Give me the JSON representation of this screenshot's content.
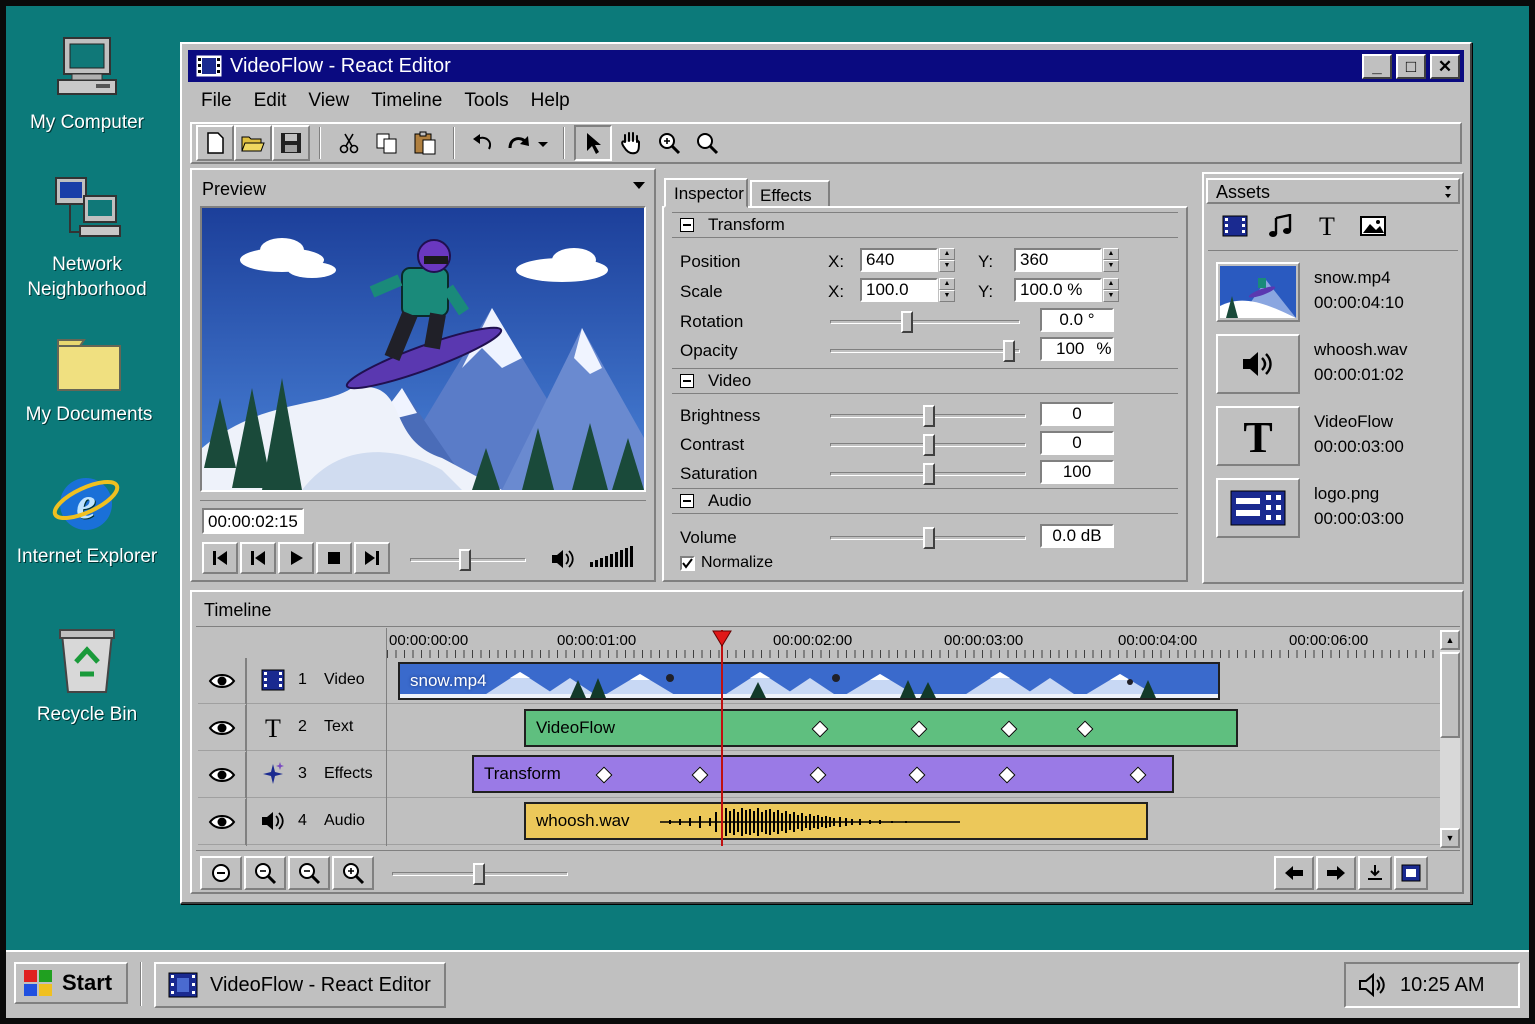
{
  "desktop": {
    "icons": [
      {
        "label": "My Computer",
        "icon": "computer-icon"
      },
      {
        "label": "Network Neighborhood",
        "icon": "network-icon"
      },
      {
        "label": "My Documents",
        "icon": "folder-icon"
      },
      {
        "label": "Internet Explorer",
        "icon": "ie-icon"
      },
      {
        "label": "Recycle Bin",
        "icon": "recycle-bin-icon"
      }
    ]
  },
  "window": {
    "title": "VideoFlow - React Editor",
    "controls": {
      "minimize": "_",
      "maximize": "□",
      "close": "✕"
    }
  },
  "menu": [
    "File",
    "Edit",
    "View",
    "Timeline",
    "Tools",
    "Help"
  ],
  "toolbar": {
    "tools": [
      "new-icon",
      "open-icon",
      "save-icon",
      "cut-icon",
      "copy-icon",
      "paste-icon",
      "undo-icon",
      "redo-icon",
      "select-icon",
      "hand-icon",
      "zoom-in-icon",
      "zoom-out-icon"
    ]
  },
  "preview": {
    "title": "Preview",
    "timecode": "00:00:02:15"
  },
  "inspector": {
    "tabs": [
      "Inspector",
      "Effects"
    ],
    "transform": {
      "title": "Transform",
      "position_label": "Position",
      "pos_x_label": "X:",
      "pos_x": "640",
      "pos_y_label": "Y:",
      "pos_y": "360",
      "scale_label": "Scale",
      "scale_x_label": "X:",
      "scale_x": "100.0",
      "scale_y_label": "Y:",
      "scale_y": "100.0 %",
      "rotation_label": "Rotation",
      "rotation": "0.0 °",
      "opacity_label": "Opacity",
      "opacity": "100",
      "opacity_unit": "%"
    },
    "video": {
      "title": "Video",
      "brightness_label": "Brightness",
      "brightness": "0",
      "contrast_label": "Contrast",
      "contrast": "0",
      "saturation_label": "Saturation",
      "saturation": "100"
    },
    "audio": {
      "title": "Audio",
      "volume_label": "Volume",
      "volume": "0.0 dB",
      "normalize_label": "Normalize",
      "normalize_checked": true
    }
  },
  "assets": {
    "title": "Assets",
    "items": [
      {
        "name": "snow.mp4",
        "duration": "00:00:04:10",
        "icon": "video-thumbnail"
      },
      {
        "name": "whoosh.wav",
        "duration": "00:00:01:02",
        "icon": "speaker-icon"
      },
      {
        "name": "VideoFlow",
        "duration": "00:00:03:00",
        "icon": "text-icon"
      },
      {
        "name": "logo.png",
        "duration": "00:00:03:00",
        "icon": "image-icon"
      }
    ]
  },
  "timeline": {
    "title": "Timeline",
    "ruler": [
      "00:00:00:00",
      "00:00:01:00",
      "00:00:02:00",
      "00:00:03:00",
      "00:00:04:00",
      "00:00:06:00"
    ],
    "tracks": [
      {
        "num": "1",
        "name": "Video",
        "icon": "film-icon"
      },
      {
        "num": "2",
        "name": "Text",
        "icon": "text-icon"
      },
      {
        "num": "3",
        "name": "Effects",
        "icon": "sparkle-icon"
      },
      {
        "num": "4",
        "name": "Audio",
        "icon": "speaker-icon"
      }
    ],
    "clips": {
      "video": "snow.mp4",
      "text": "VideoFlow",
      "effects": "Transform",
      "audio": "whoosh.wav"
    }
  },
  "taskbar": {
    "start": "Start",
    "task": "VideoFlow - React Editor",
    "clock": "10:25 AM"
  }
}
